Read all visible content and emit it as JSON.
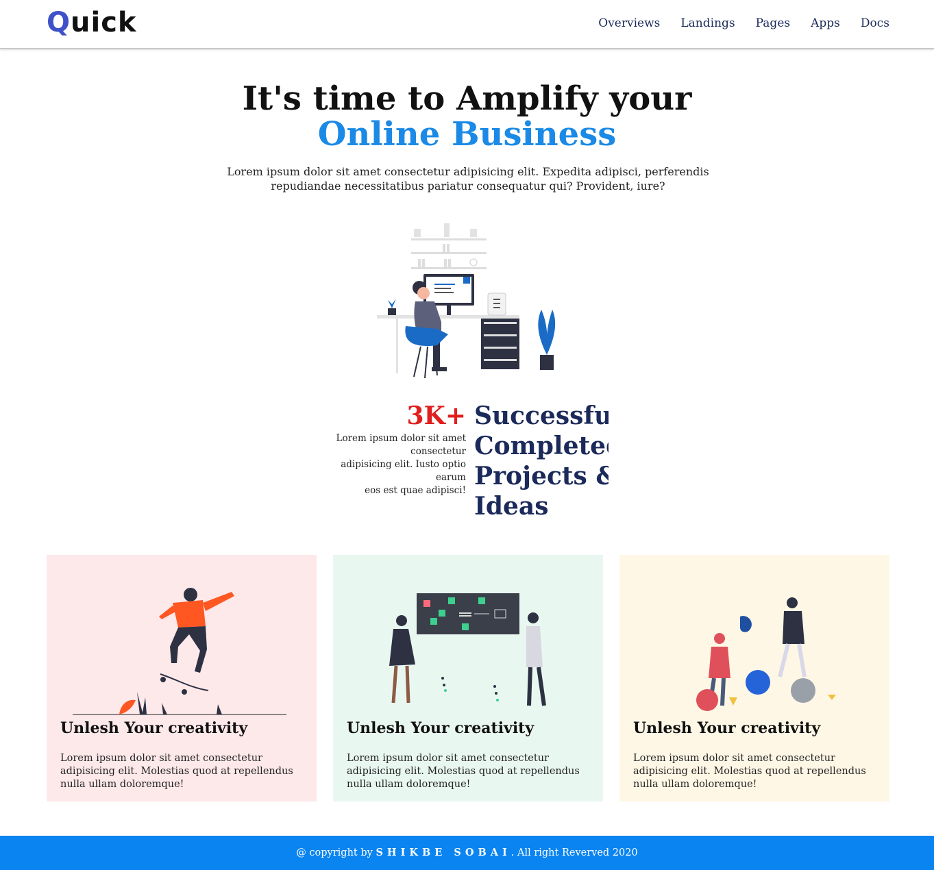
{
  "header": {
    "logo_first": "Q",
    "logo_rest": "uick",
    "nav": [
      "Overviews",
      "Landings",
      "Pages",
      "Apps",
      "Docs"
    ]
  },
  "hero": {
    "title_line1": "It's time to Amplify your",
    "title_line2": "Online Business",
    "text": "Lorem ipsum dolor sit amet consectetur adipisicing elit. Expedita adipisci, perferendis repudiandae necessitatibus pariatur consequatur qui? Provident, iure?"
  },
  "stats": {
    "number": "3K+",
    "desc_lines": [
      "Lorem ipsum dolor sit amet",
      "consectetur",
      "adipisicing elit. Iusto optio",
      "earum",
      "eos est quae adipisci!"
    ],
    "heading_lines": [
      "Successfully",
      "Completed",
      "Projects &",
      "Ideas"
    ]
  },
  "cards": [
    {
      "title": "Unlesh Your creativity",
      "text": "Lorem ipsum dolor sit amet consectetur adipisicing elit. Molestias quod at repellendus nulla ullam doloremque!"
    },
    {
      "title": "Unlesh Your creativity",
      "text": "Lorem ipsum dolor sit amet consectetur adipisicing elit. Molestias quod at repellendus nulla ullam doloremque!"
    },
    {
      "title": "Unlesh Your creativity",
      "text": "Lorem ipsum dolor sit amet consectetur adipisicing elit. Molestias quod at repellendus nulla ullam doloremque!"
    }
  ],
  "footer": {
    "prefix": "@ copyright by ",
    "brand": "SHIKBE SOBAI",
    "suffix": ". All right Reverved 2020"
  },
  "colors": {
    "accent_blue": "#1a8ae6",
    "footer_blue": "#0a84f0",
    "stat_red": "#e01e1e",
    "navy": "#1b2a5a",
    "card_pink": "#fde8ea",
    "card_mint": "#e9f7f1",
    "card_cream": "#fff7e6"
  }
}
